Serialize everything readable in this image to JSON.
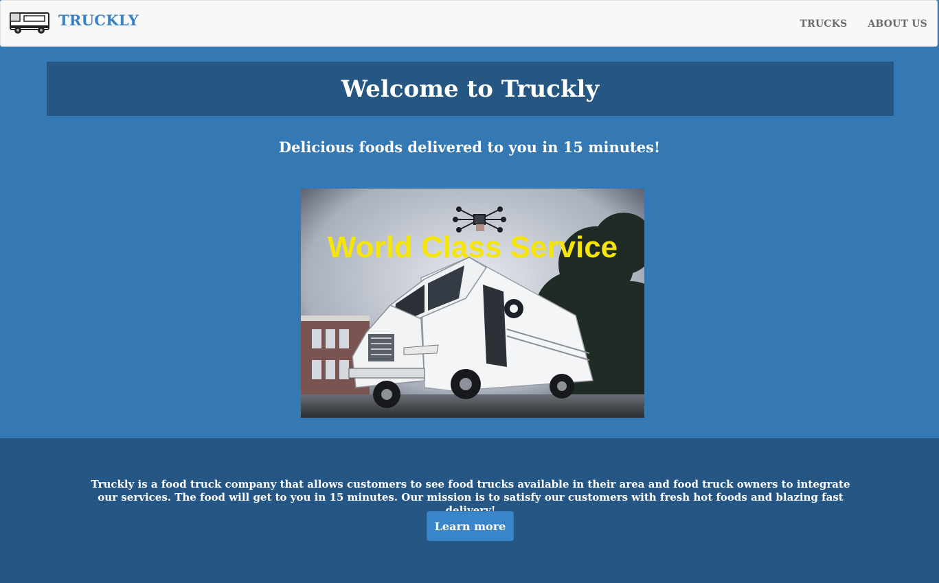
{
  "nav": {
    "brand": "TRUCKLY",
    "links": [
      "TRUCKS",
      "ABOUT US"
    ],
    "logo_icon": "food-truck-icon"
  },
  "hero": {
    "title": "Welcome to Truckly",
    "tagline": "Delicious foods delivered to you in 15 minutes!",
    "image_caption": "World Class Service"
  },
  "about": {
    "text": "Truckly is a food truck company that allows customers to see food trucks available in their area and food truck owners to integrate our services. The food will get to you in 15 minutes. Our mission is to satisfy our customers with fresh hot foods and blazing fast delivery!",
    "button_label": "Learn more"
  },
  "colors": {
    "page_bg": "#3478b4",
    "banner_bg": "#255782",
    "footer_bg": "#265683",
    "brand": "#3a82c4",
    "button": "#3a86cc",
    "caption": "#f5e50a"
  }
}
